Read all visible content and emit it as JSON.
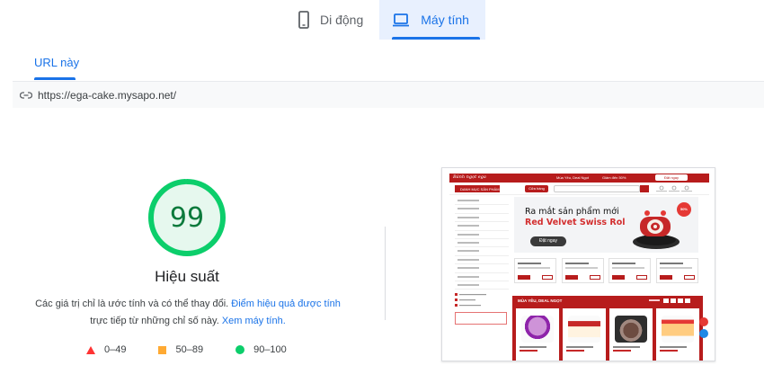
{
  "device_tabs": [
    {
      "label": "Di động",
      "icon": "phone-icon",
      "active": false
    },
    {
      "label": "Máy tính",
      "icon": "laptop-icon",
      "active": true
    }
  ],
  "url_tab": {
    "label": "URL này"
  },
  "url_bar": {
    "url": "https://ega-cake.mysapo.net/",
    "icon": "link-icon"
  },
  "score": {
    "value": "99",
    "fraction": 0.99,
    "label": "Hiệu suất",
    "color": "#0cce6b",
    "text_color": "#0c7a3c",
    "bg_color": "#e6f8ee"
  },
  "description": {
    "text_before": "Các giá trị chỉ là ước tính và có thể thay đổi. ",
    "link1": "Điểm hiệu quả được tính",
    "text_middle": " trực tiếp từ những chỉ số này. ",
    "link2": "Xem máy tính."
  },
  "legend": [
    {
      "range": "0–49",
      "shape": "triangle",
      "color": "#ff3333"
    },
    {
      "range": "50–89",
      "shape": "square",
      "color": "#ffaa33"
    },
    {
      "range": "90–100",
      "shape": "circle",
      "color": "#0cce6b"
    }
  ],
  "thumbnail": {
    "logo": "Bánh ngọt ega",
    "top_text_1": "Mùa Yêu, Deal Ngọt",
    "top_text_2": "Giảm đến 50%",
    "top_button": "Đặt ngay",
    "menu_label": "DANH MỤC SẢN PHẨM",
    "store_button": "Cửa hàng",
    "banner_title": "Ra mắt sản phẩm mới",
    "banner_subtitle": "Red Velvet Swiss Rol",
    "banner_button": "Đặt ngay",
    "banner_badge": "50%",
    "deal_title": "MÙA YÊU, DEAL NGỌT",
    "accent_color": "#b71c1c"
  }
}
